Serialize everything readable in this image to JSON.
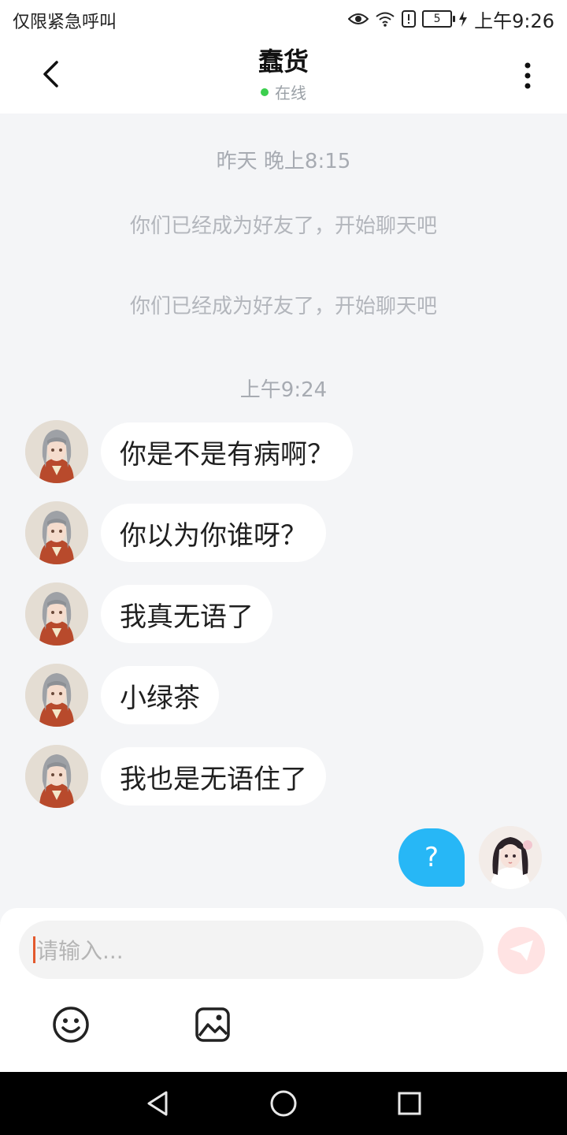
{
  "status_bar": {
    "left_text": "仅限紧急呼叫",
    "battery_level": "5",
    "time": "上午9:26",
    "icons": [
      "eye-icon",
      "wifi-icon",
      "alert-icon",
      "battery-icon",
      "charging-icon"
    ]
  },
  "header": {
    "title": "蠢货",
    "status": "在线",
    "status_color": "#3ccf4e",
    "back_icon": "chevron-left-icon",
    "more_icon": "more-vertical-icon"
  },
  "chat": {
    "time_1": "昨天 晚上8:15",
    "system_1": "你们已经成为好友了，开始聊天吧",
    "system_2": "你们已经成为好友了，开始聊天吧",
    "time_2": "上午9:24",
    "incoming": [
      {
        "text": "你是不是有病啊？"
      },
      {
        "text": "你以为你谁呀？"
      },
      {
        "text": "我真无语了"
      },
      {
        "text": "小绿茶"
      },
      {
        "text": "我也是无语住了"
      }
    ],
    "outgoing": [
      {
        "text": "?"
      }
    ],
    "bubble_colors": {
      "incoming": "#ffffff",
      "outgoing": "#27b7f6"
    }
  },
  "composer": {
    "placeholder": "请输入...",
    "send_icon": "send-icon",
    "tools": [
      "emoji-icon",
      "image-icon"
    ]
  },
  "nav_bar": {
    "buttons": [
      "back-triangle-icon",
      "home-circle-icon",
      "recents-square-icon"
    ]
  }
}
